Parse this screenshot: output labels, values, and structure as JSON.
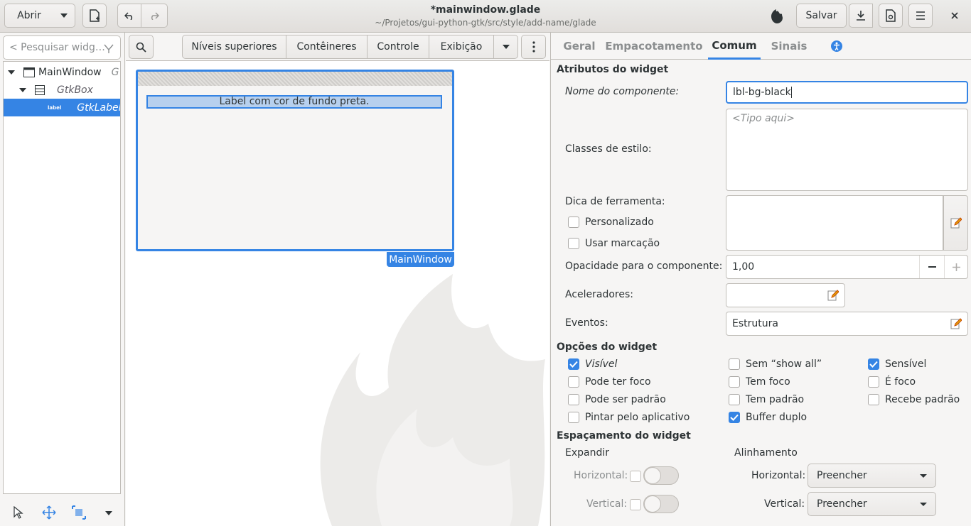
{
  "header": {
    "open_label": "Abrir",
    "title": "*mainwindow.glade",
    "subtitle": "~/Projetos/gui-python-gtk/src/style/add-name/glade",
    "save_label": "Salvar"
  },
  "left": {
    "search_placeholder": "< Pesquisar widg…",
    "tree": [
      {
        "label": "MainWindow",
        "extra": "G"
      },
      {
        "label": "GtkBox"
      },
      {
        "label": "GtkLabel",
        "icon_text": "label"
      }
    ]
  },
  "palette": {
    "buttons": [
      "Níveis superiores",
      "Contêineres",
      "Controle",
      "Exibição"
    ]
  },
  "design": {
    "label_text": "Label com cor de fundo preta.",
    "window_tag": "MainWindow"
  },
  "inspector": {
    "tabs": [
      "Geral",
      "Empacotamento",
      "Comum",
      "Sinais"
    ],
    "active_tab": "Comum",
    "section_attrs": "Atributos do widget",
    "name_label": "Nome do componente:",
    "name_value": "lbl-bg-black",
    "style_label": "Classes de estilo:",
    "style_placeholder": "<Tipo aqui>",
    "tooltip_label": "Dica de ferramenta:",
    "custom_label": "Personalizado",
    "markup_label": "Usar marcação",
    "opacity_label": "Opacidade para o componente:",
    "opacity_value": "1,00",
    "accel_label": "Aceleradores:",
    "events_label": "Eventos:",
    "events_value": "Estrutura",
    "section_options": "Opções do widget",
    "options": [
      {
        "label": "Visível",
        "checked": true
      },
      {
        "label": "Sem “show all”",
        "checked": false
      },
      {
        "label": "Sensível",
        "checked": true
      },
      {
        "label": "Pode ter foco",
        "checked": false
      },
      {
        "label": "Tem foco",
        "checked": false
      },
      {
        "label": "É foco",
        "checked": false
      },
      {
        "label": "Pode ser padrão",
        "checked": false
      },
      {
        "label": "Tem padrão",
        "checked": false
      },
      {
        "label": "Recebe padrão",
        "checked": false
      },
      {
        "label": "Pintar pelo aplicativo",
        "checked": false
      },
      {
        "label": "Buffer duplo",
        "checked": true
      }
    ],
    "section_spacing": "Espaçamento do widget",
    "expand_label": "Expandir",
    "align_label": "Alinhamento",
    "horizontal_label": "Horizontal:",
    "vertical_label": "Vertical:",
    "h_align_value": "Preencher",
    "v_align_value": "Preencher"
  },
  "colors": {
    "accent": "#3584e4"
  }
}
